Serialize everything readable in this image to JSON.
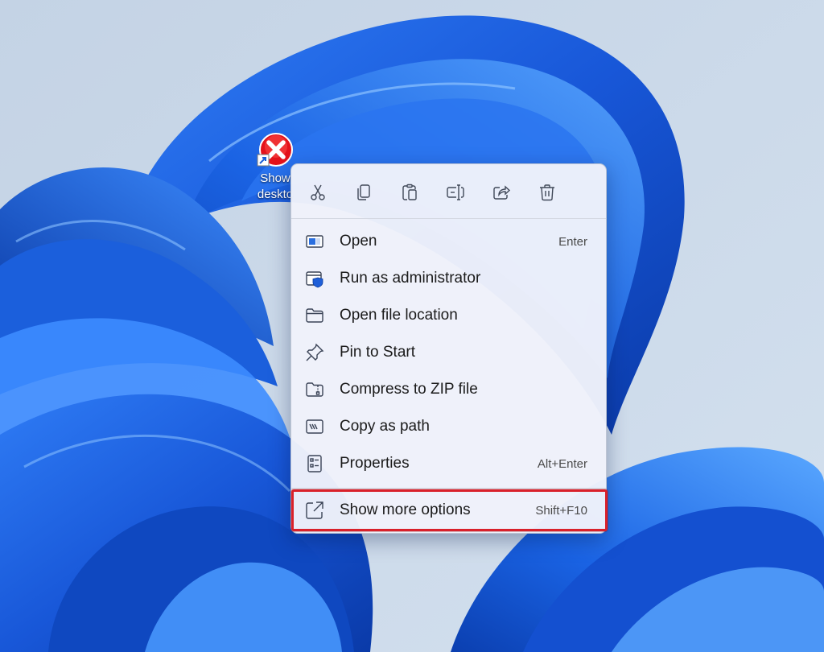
{
  "desktop": {
    "shortcut": {
      "label": "Show\ndeskto",
      "icon": "error-shortcut-icon"
    }
  },
  "context_menu": {
    "toolbar": [
      {
        "action": "Cut",
        "icon": "cut-icon"
      },
      {
        "action": "Copy",
        "icon": "copy-icon"
      },
      {
        "action": "Paste",
        "icon": "paste-icon"
      },
      {
        "action": "Rename",
        "icon": "rename-icon"
      },
      {
        "action": "Share",
        "icon": "share-icon"
      },
      {
        "action": "Delete",
        "icon": "delete-icon"
      }
    ],
    "items": [
      {
        "label": "Open",
        "shortcut": "Enter",
        "icon": "open-app-icon"
      },
      {
        "label": "Run as administrator",
        "shortcut": "",
        "icon": "shield-icon"
      },
      {
        "label": "Open file location",
        "shortcut": "",
        "icon": "folder-icon"
      },
      {
        "label": "Pin to Start",
        "shortcut": "",
        "icon": "pin-icon"
      },
      {
        "label": "Compress to ZIP file",
        "shortcut": "",
        "icon": "zip-folder-icon"
      },
      {
        "label": "Copy as path",
        "shortcut": "",
        "icon": "path-icon"
      },
      {
        "label": "Properties",
        "shortcut": "Alt+Enter",
        "icon": "properties-icon"
      },
      {
        "label": "Show more options",
        "shortcut": "Shift+F10",
        "icon": "more-options-icon"
      }
    ]
  },
  "colors": {
    "wallpaper_base": "#c7d6e6",
    "bloom_dark": "#0a3fb8",
    "bloom_mid": "#1a66e6",
    "bloom_light": "#58a6ff",
    "highlight_border": "#d9202a",
    "menu_background": "#eff2fa"
  }
}
